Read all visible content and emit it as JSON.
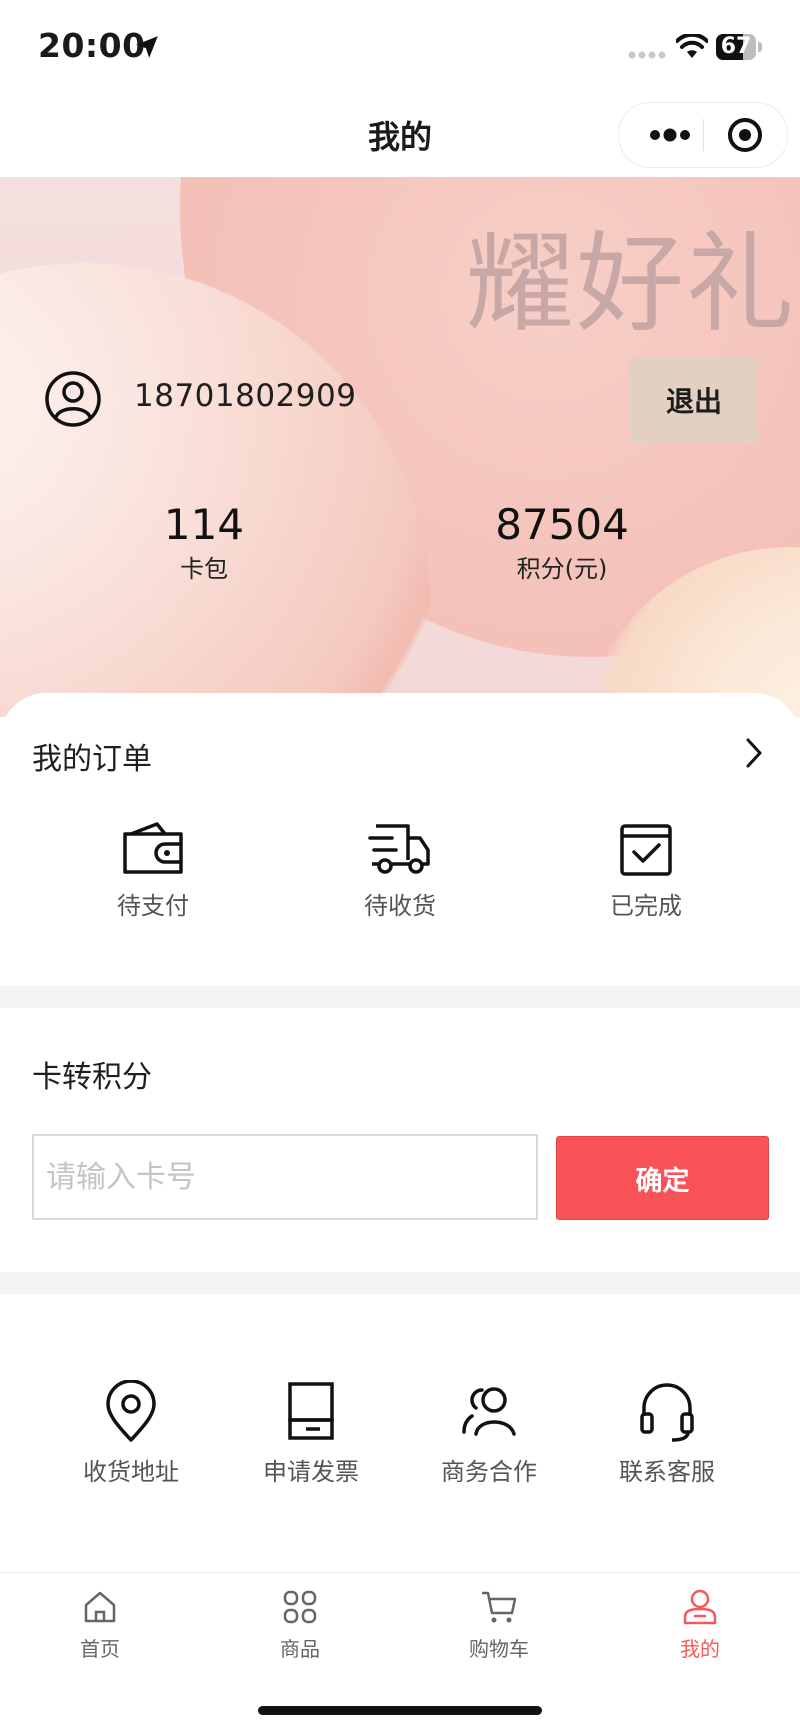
{
  "status_bar": {
    "time": "20:00",
    "battery": "67",
    "battery_level": 0.67
  },
  "nav": {
    "title": "我的"
  },
  "hero": {
    "brand": "耀好礼",
    "phone": "18701802909",
    "logout_label": "退出",
    "stats": [
      {
        "value": "114",
        "label": "卡包"
      },
      {
        "value": "87504",
        "label": "积分(元)"
      }
    ]
  },
  "orders": {
    "title": "我的订单",
    "items": [
      {
        "label": "待支付",
        "icon": "wallet-icon"
      },
      {
        "label": "待收货",
        "icon": "truck-icon"
      },
      {
        "label": "已完成",
        "icon": "calendar-check-icon"
      }
    ]
  },
  "card_convert": {
    "title": "卡转积分",
    "placeholder": "请输入卡号",
    "confirm_label": "确定"
  },
  "services": [
    {
      "label": "收货地址",
      "icon": "location-pin-icon"
    },
    {
      "label": "申请发票",
      "icon": "invoice-icon"
    },
    {
      "label": "商务合作",
      "icon": "partners-icon"
    },
    {
      "label": "联系客服",
      "icon": "headset-icon"
    }
  ],
  "tabbar": {
    "items": [
      {
        "label": "首页",
        "icon": "home-icon",
        "active": false
      },
      {
        "label": "商品",
        "icon": "grid-icon",
        "active": false
      },
      {
        "label": "购物车",
        "icon": "cart-icon",
        "active": false
      },
      {
        "label": "我的",
        "icon": "user-icon",
        "active": true
      }
    ]
  },
  "colors": {
    "accent": "#f95358",
    "active_tab": "#f55a5a",
    "logout_bg": "#e3d0c2"
  }
}
